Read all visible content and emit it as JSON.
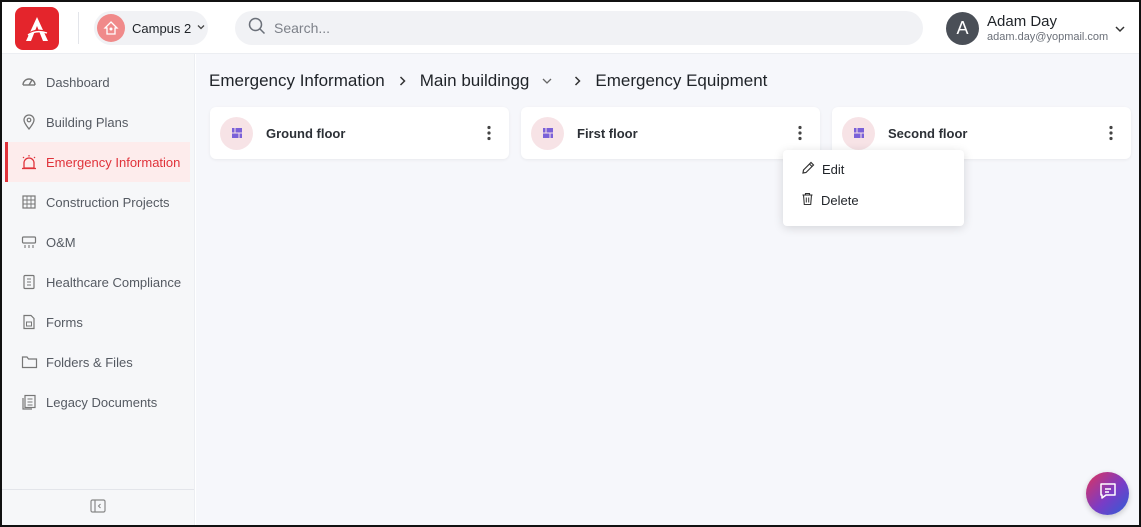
{
  "campus": {
    "label": "Campus 2"
  },
  "search": {
    "placeholder": "Search..."
  },
  "user": {
    "initial": "A",
    "name": "Adam Day",
    "email": "adam.day@yopmail.com"
  },
  "sidebar": {
    "items": [
      {
        "label": "Dashboard",
        "icon": "dashboard-icon"
      },
      {
        "label": "Building Plans",
        "icon": "map-pin-icon"
      },
      {
        "label": "Emergency Information",
        "icon": "alarm-icon",
        "active": true
      },
      {
        "label": "Construction Projects",
        "icon": "construction-icon"
      },
      {
        "label": "O&M",
        "icon": "air-conditioner-icon"
      },
      {
        "label": "Healthcare Compliance",
        "icon": "notebook-icon"
      },
      {
        "label": "Forms",
        "icon": "form-icon"
      },
      {
        "label": "Folders & Files",
        "icon": "folder-icon"
      },
      {
        "label": "Legacy Documents",
        "icon": "documents-icon"
      }
    ]
  },
  "breadcrumb": {
    "level1": "Emergency Information",
    "level2": "Main buildingg",
    "level3": "Emergency Equipment"
  },
  "cards": [
    {
      "label": "Ground floor"
    },
    {
      "label": "First floor"
    },
    {
      "label": "Second floor"
    }
  ],
  "menu": {
    "edit": "Edit",
    "delete": "Delete"
  },
  "colors": {
    "accent": "#e4252c",
    "active_bg": "#fdecec",
    "card_icon": "#7b61d8"
  }
}
